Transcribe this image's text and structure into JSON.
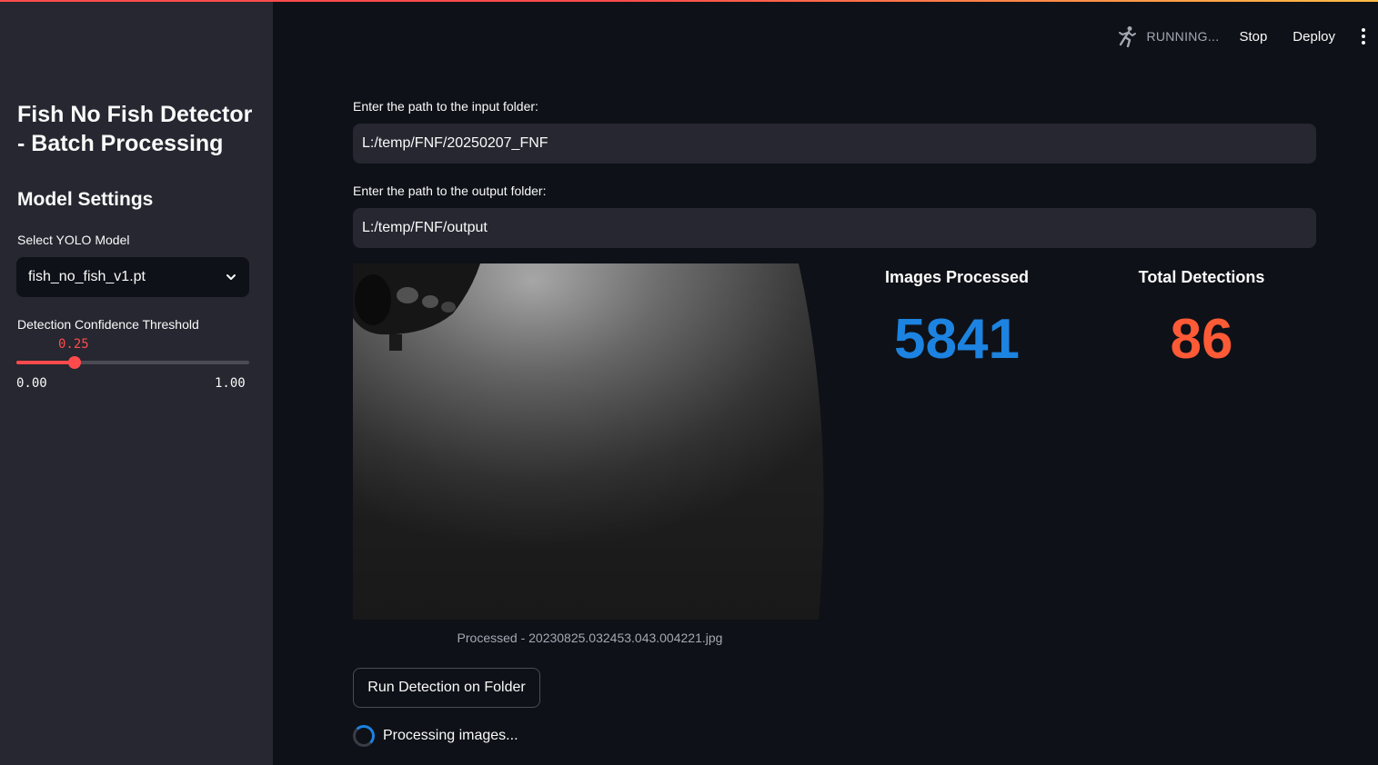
{
  "sidebar": {
    "title": "Fish No Fish Detector - Batch Processing",
    "section": "Model Settings",
    "model_label": "Select YOLO Model",
    "model_value": "fish_no_fish_v1.pt",
    "confidence_label": "Detection Confidence Threshold",
    "confidence": {
      "value_text": "0.25",
      "value": 0.25,
      "min_text": "0.00",
      "max_text": "1.00",
      "min": 0,
      "max": 1
    }
  },
  "toolbar": {
    "status": "RUNNING...",
    "stop_label": "Stop",
    "deploy_label": "Deploy",
    "status_icon": "running-man-icon",
    "menu_icon": "kebab-menu-icon"
  },
  "main": {
    "input_label": "Enter the path to the input folder:",
    "input_value": "L:/temp/FNF/20250207_FNF",
    "output_label": "Enter the path to the output folder:",
    "output_value": "L:/temp/FNF/output",
    "image_caption": "Processed - 20230825.032453.043.004221.jpg",
    "metrics": [
      {
        "label": "Images Processed",
        "value": "5841",
        "color": "#1c83e1"
      },
      {
        "label": "Total Detections",
        "value": "86",
        "color": "#ff5a36"
      }
    ],
    "run_button": "Run Detection on Folder",
    "status_text": "Processing images..."
  },
  "colors": {
    "accent": "#ff4b4b",
    "sidebar_bg": "#262730",
    "main_bg": "#0e1117",
    "spinner": "#1c83e1"
  }
}
